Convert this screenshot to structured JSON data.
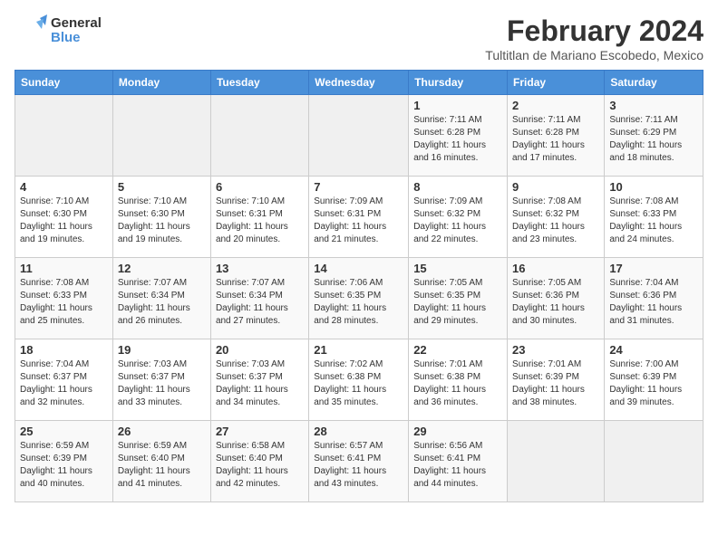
{
  "header": {
    "logo_general": "General",
    "logo_blue": "Blue",
    "title": "February 2024",
    "subtitle": "Tultitlan de Mariano Escobedo, Mexico"
  },
  "days_of_week": [
    "Sunday",
    "Monday",
    "Tuesday",
    "Wednesday",
    "Thursday",
    "Friday",
    "Saturday"
  ],
  "weeks": [
    [
      {
        "day": "",
        "info": ""
      },
      {
        "day": "",
        "info": ""
      },
      {
        "day": "",
        "info": ""
      },
      {
        "day": "",
        "info": ""
      },
      {
        "day": "1",
        "info": "Sunrise: 7:11 AM\nSunset: 6:28 PM\nDaylight: 11 hours and 16 minutes."
      },
      {
        "day": "2",
        "info": "Sunrise: 7:11 AM\nSunset: 6:28 PM\nDaylight: 11 hours and 17 minutes."
      },
      {
        "day": "3",
        "info": "Sunrise: 7:11 AM\nSunset: 6:29 PM\nDaylight: 11 hours and 18 minutes."
      }
    ],
    [
      {
        "day": "4",
        "info": "Sunrise: 7:10 AM\nSunset: 6:30 PM\nDaylight: 11 hours and 19 minutes."
      },
      {
        "day": "5",
        "info": "Sunrise: 7:10 AM\nSunset: 6:30 PM\nDaylight: 11 hours and 19 minutes."
      },
      {
        "day": "6",
        "info": "Sunrise: 7:10 AM\nSunset: 6:31 PM\nDaylight: 11 hours and 20 minutes."
      },
      {
        "day": "7",
        "info": "Sunrise: 7:09 AM\nSunset: 6:31 PM\nDaylight: 11 hours and 21 minutes."
      },
      {
        "day": "8",
        "info": "Sunrise: 7:09 AM\nSunset: 6:32 PM\nDaylight: 11 hours and 22 minutes."
      },
      {
        "day": "9",
        "info": "Sunrise: 7:08 AM\nSunset: 6:32 PM\nDaylight: 11 hours and 23 minutes."
      },
      {
        "day": "10",
        "info": "Sunrise: 7:08 AM\nSunset: 6:33 PM\nDaylight: 11 hours and 24 minutes."
      }
    ],
    [
      {
        "day": "11",
        "info": "Sunrise: 7:08 AM\nSunset: 6:33 PM\nDaylight: 11 hours and 25 minutes."
      },
      {
        "day": "12",
        "info": "Sunrise: 7:07 AM\nSunset: 6:34 PM\nDaylight: 11 hours and 26 minutes."
      },
      {
        "day": "13",
        "info": "Sunrise: 7:07 AM\nSunset: 6:34 PM\nDaylight: 11 hours and 27 minutes."
      },
      {
        "day": "14",
        "info": "Sunrise: 7:06 AM\nSunset: 6:35 PM\nDaylight: 11 hours and 28 minutes."
      },
      {
        "day": "15",
        "info": "Sunrise: 7:05 AM\nSunset: 6:35 PM\nDaylight: 11 hours and 29 minutes."
      },
      {
        "day": "16",
        "info": "Sunrise: 7:05 AM\nSunset: 6:36 PM\nDaylight: 11 hours and 30 minutes."
      },
      {
        "day": "17",
        "info": "Sunrise: 7:04 AM\nSunset: 6:36 PM\nDaylight: 11 hours and 31 minutes."
      }
    ],
    [
      {
        "day": "18",
        "info": "Sunrise: 7:04 AM\nSunset: 6:37 PM\nDaylight: 11 hours and 32 minutes."
      },
      {
        "day": "19",
        "info": "Sunrise: 7:03 AM\nSunset: 6:37 PM\nDaylight: 11 hours and 33 minutes."
      },
      {
        "day": "20",
        "info": "Sunrise: 7:03 AM\nSunset: 6:37 PM\nDaylight: 11 hours and 34 minutes."
      },
      {
        "day": "21",
        "info": "Sunrise: 7:02 AM\nSunset: 6:38 PM\nDaylight: 11 hours and 35 minutes."
      },
      {
        "day": "22",
        "info": "Sunrise: 7:01 AM\nSunset: 6:38 PM\nDaylight: 11 hours and 36 minutes."
      },
      {
        "day": "23",
        "info": "Sunrise: 7:01 AM\nSunset: 6:39 PM\nDaylight: 11 hours and 38 minutes."
      },
      {
        "day": "24",
        "info": "Sunrise: 7:00 AM\nSunset: 6:39 PM\nDaylight: 11 hours and 39 minutes."
      }
    ],
    [
      {
        "day": "25",
        "info": "Sunrise: 6:59 AM\nSunset: 6:39 PM\nDaylight: 11 hours and 40 minutes."
      },
      {
        "day": "26",
        "info": "Sunrise: 6:59 AM\nSunset: 6:40 PM\nDaylight: 11 hours and 41 minutes."
      },
      {
        "day": "27",
        "info": "Sunrise: 6:58 AM\nSunset: 6:40 PM\nDaylight: 11 hours and 42 minutes."
      },
      {
        "day": "28",
        "info": "Sunrise: 6:57 AM\nSunset: 6:41 PM\nDaylight: 11 hours and 43 minutes."
      },
      {
        "day": "29",
        "info": "Sunrise: 6:56 AM\nSunset: 6:41 PM\nDaylight: 11 hours and 44 minutes."
      },
      {
        "day": "",
        "info": ""
      },
      {
        "day": "",
        "info": ""
      }
    ]
  ]
}
